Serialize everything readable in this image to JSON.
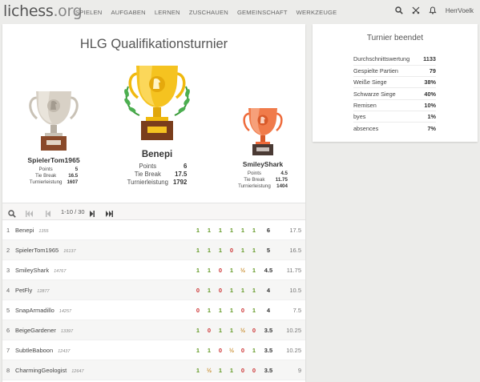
{
  "header": {
    "logo_main": "lichess",
    "logo_tld": ".org",
    "nav": [
      "SPIELEN",
      "AUFGABEN",
      "LERNEN",
      "ZUSCHAUEN",
      "GEMEINSCHAFT",
      "WERKZEUGE"
    ],
    "username": "HerrVoelk"
  },
  "tournament": {
    "title": "HLG Qualifikationsturnier",
    "podium": [
      {
        "place": 2,
        "name": "SpielerTom1965",
        "points_label": "Points",
        "points": "5",
        "tiebreak_label": "Tie Break",
        "tiebreak": "16.5",
        "perf_label": "Turnierleistung",
        "perf": "1607",
        "cup_color": "silver"
      },
      {
        "place": 1,
        "name": "Benepi",
        "points_label": "Points",
        "points": "6",
        "tiebreak_label": "Tie Break",
        "tiebreak": "17.5",
        "perf_label": "Turnierleistung",
        "perf": "1792",
        "cup_color": "gold"
      },
      {
        "place": 3,
        "name": "SmileyShark",
        "points_label": "Points",
        "points": "4.5",
        "tiebreak_label": "Tie Break",
        "tiebreak": "11.75",
        "perf_label": "Turnierleistung",
        "perf": "1404",
        "cup_color": "bronze"
      }
    ]
  },
  "pager": {
    "range": "1-10 / 30"
  },
  "standings": [
    {
      "rank": "1",
      "name": "Benepi",
      "rating": "1355",
      "results": [
        "1",
        "1",
        "1",
        "1",
        "1",
        "1"
      ],
      "total": "6",
      "tiebreak": "17.5"
    },
    {
      "rank": "2",
      "name": "SpielerTom1965",
      "rating": "16137",
      "results": [
        "1",
        "1",
        "1",
        "0",
        "1",
        "1"
      ],
      "total": "5",
      "tiebreak": "16.5"
    },
    {
      "rank": "3",
      "name": "SmileyShark",
      "rating": "14767",
      "results": [
        "1",
        "1",
        "0",
        "1",
        "½",
        "1"
      ],
      "total": "4.5",
      "tiebreak": "11.75"
    },
    {
      "rank": "4",
      "name": "PetFly",
      "rating": "12877",
      "results": [
        "0",
        "1",
        "0",
        "1",
        "1",
        "1"
      ],
      "total": "4",
      "tiebreak": "10.5"
    },
    {
      "rank": "5",
      "name": "SnapArmadillo",
      "rating": "14257",
      "results": [
        "0",
        "1",
        "1",
        "1",
        "0",
        "1"
      ],
      "total": "4",
      "tiebreak": "7.5"
    },
    {
      "rank": "6",
      "name": "BeigeGardener",
      "rating": "13397",
      "results": [
        "1",
        "0",
        "1",
        "1",
        "½",
        "0"
      ],
      "total": "3.5",
      "tiebreak": "10.25"
    },
    {
      "rank": "7",
      "name": "SubtleBaboon",
      "rating": "12437",
      "results": [
        "1",
        "1",
        "0",
        "½",
        "0",
        "1"
      ],
      "total": "3.5",
      "tiebreak": "10.25"
    },
    {
      "rank": "8",
      "name": "CharmingGeologist",
      "rating": "12647",
      "results": [
        "1",
        "½",
        "1",
        "1",
        "0",
        "0"
      ],
      "total": "3.5",
      "tiebreak": "9"
    }
  ],
  "summary": {
    "title": "Turnier beendet",
    "rows": [
      {
        "label": "Durchschnittswertung",
        "value": "1133"
      },
      {
        "label": "Gespielte Partien",
        "value": "79"
      },
      {
        "label": "Weiße Siege",
        "value": "38%"
      },
      {
        "label": "Schwarze Siege",
        "value": "40%"
      },
      {
        "label": "Remisen",
        "value": "10%"
      },
      {
        "label": "byes",
        "value": "1%"
      },
      {
        "label": "absences",
        "value": "7%"
      }
    ]
  },
  "colors": {
    "win": "#629924",
    "loss": "#cc3333",
    "draw": "#c88b2a"
  },
  "icons": [
    "search-icon",
    "swords-icon",
    "bell-icon",
    "first-page-icon",
    "prev-page-icon",
    "next-page-icon",
    "last-page-icon",
    "trophy-icon"
  ]
}
